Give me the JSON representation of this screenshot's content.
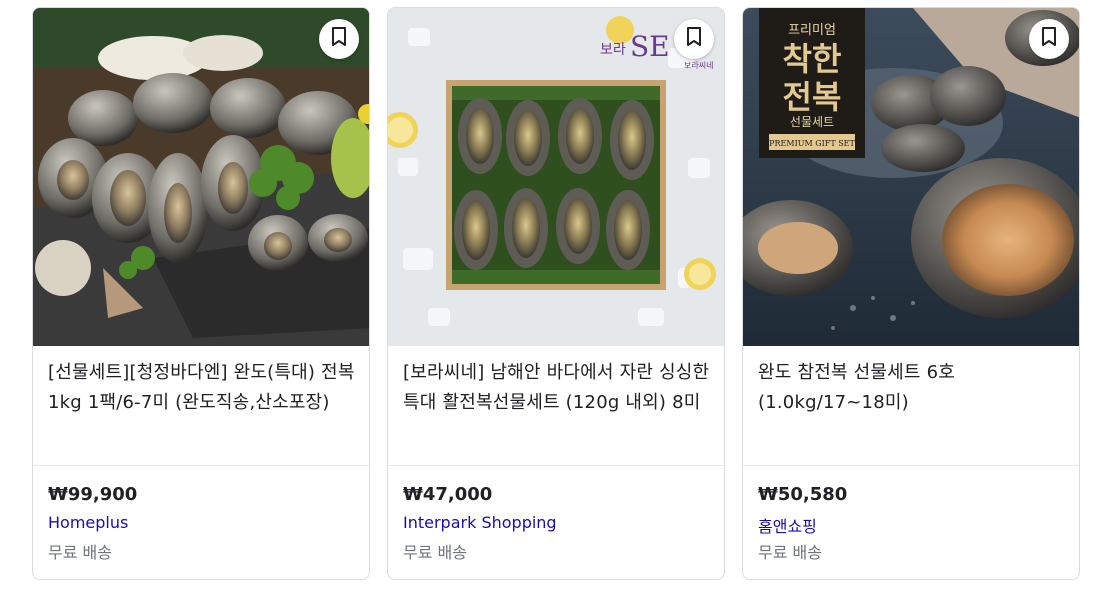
{
  "products": [
    {
      "title": "[선물세트][청정바다엔] 완도(특대) 전복 1kg 1팩/6-7미 (완도직송,산소포장)",
      "price": "₩99,900",
      "merchant": "Homeplus",
      "shipping": "무료 배송",
      "image_alt": "abalone on slate platter with garnish"
    },
    {
      "title": "[보라씨네] 남해안 바다에서 자란 싱싱한 특대 활전복선물세트 (120g 내외) 8미",
      "price": "₩47,000",
      "merchant": "Interpark Shopping",
      "shipping": "무료 배송",
      "image_alt": "eight abalone in wooden box on ice",
      "image_logo": "보라SE씨네",
      "image_logo_sub": "보라씨네"
    },
    {
      "title": "완도 참전복 선물세트 6호 (1.0kg/17~18미)",
      "price": "₩50,580",
      "merchant": "홈앤쇼핑",
      "shipping": "무료 배송",
      "image_alt": "premium abalone gift set",
      "image_label_top": "프리미엄",
      "image_label_main1": "착한",
      "image_label_main2": "전복",
      "image_label_sub": "선물세트",
      "image_label_en": "PREMIUM GIFT SET"
    }
  ],
  "colors": {
    "merchant_link": "#1a0dab",
    "muted_text": "#70757a",
    "title_text": "#202124",
    "border": "#dadce0"
  },
  "icons": {
    "save": "bookmark-icon"
  }
}
